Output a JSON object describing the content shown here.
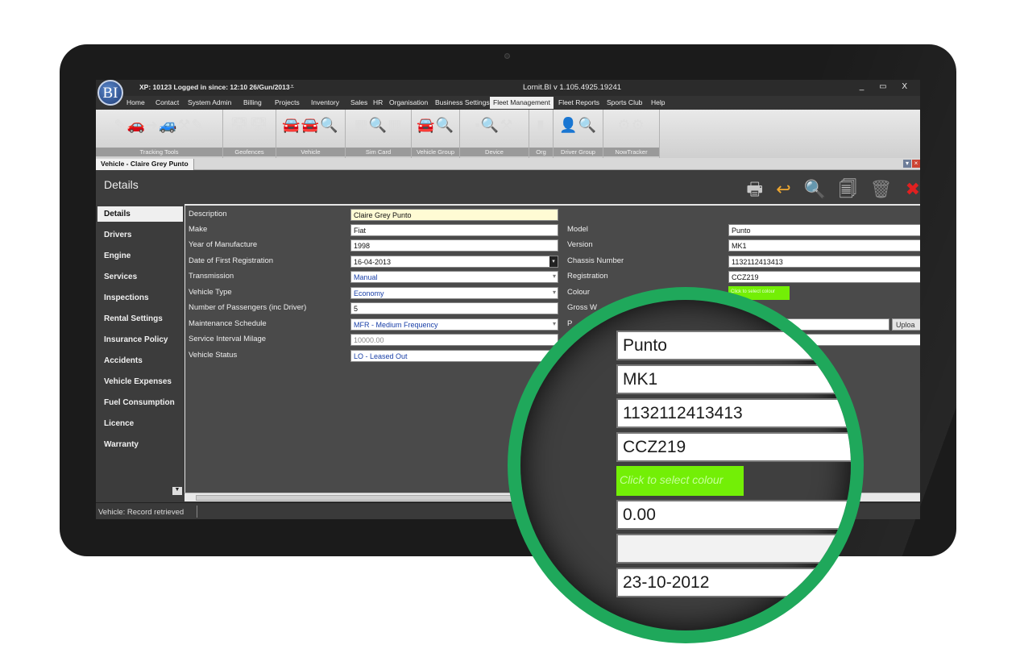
{
  "window": {
    "logo": "BI",
    "session": "XP: 10123  Logged in since: 12:10 26/Gun/2013",
    "quick_access": "⩡",
    "app_title": "Lornit.BI v 1.105.4925.19241",
    "controls": "_ ▭ X"
  },
  "menu": [
    {
      "label": "Home"
    },
    {
      "label": "Contact"
    },
    {
      "label": "System Admin"
    },
    {
      "label": "Billing"
    },
    {
      "label": "Projects"
    },
    {
      "label": "Inventory"
    },
    {
      "label": "Sales"
    },
    {
      "label": "HR"
    },
    {
      "label": "Organisation"
    },
    {
      "label": "Business Settings"
    },
    {
      "label": "Fleet Management"
    },
    {
      "label": "Fleet Reports"
    },
    {
      "label": "Sports Club"
    },
    {
      "label": "Help"
    }
  ],
  "ribbon_groups": [
    {
      "label": "Tracking Tools",
      "icons": "✎🚗➜🚙⚒✎"
    },
    {
      "label": "Geofences",
      "icons": "🛣🛣"
    },
    {
      "label": "Vehicle",
      "icons": "🚘🚘🔍"
    },
    {
      "label": "Sim Card",
      "icons": "▦🔍▦"
    },
    {
      "label": "Vehicle Group",
      "icons": "🚘🔍"
    },
    {
      "label": "Device",
      "icons": "▪🔍⚒"
    },
    {
      "label": "Org",
      "icons": "▮"
    },
    {
      "label": "Driver Group",
      "icons": "👤🔍"
    },
    {
      "label": "NowTracker",
      "icons": "⚙⚙"
    }
  ],
  "doc_tab": "Vehicle - Claire Grey Punto",
  "page_title": "Details",
  "toolbar_icons": [
    "printer-icon",
    "undo-icon",
    "search-icon",
    "copy-icon",
    "delete-icon",
    "close-icon"
  ],
  "sidebar": [
    "Details",
    "Drivers",
    "Engine",
    "Services",
    "Inspections",
    "Rental Settings",
    "Insurance Policy",
    "Accidents",
    "Vehicle Expenses",
    "Fuel Consumption",
    "Licence",
    "Warranty"
  ],
  "form": {
    "description_label": "Description",
    "description_value": "Claire Grey Punto",
    "make_label": "Make",
    "make_value": "Fiat",
    "year_label": "Year of Manufacture",
    "year_value": "1998",
    "first_reg_label": "Date of First Registration",
    "first_reg_value": "16-04-2013",
    "transmission_label": "Transmission",
    "transmission_value": "Manual",
    "vehicle_type_label": "Vehicle Type",
    "vehicle_type_value": "Economy",
    "passengers_label": "Number of Passengers (inc Driver)",
    "passengers_value": "5",
    "maintenance_label": "Maintenance Schedule",
    "maintenance_value": "MFR - Medium Frequency",
    "service_interval_label": "Service Interval Milage",
    "service_interval_value": "10000.00",
    "status_label": "Vehicle Status",
    "status_value": "LO - Leased Out",
    "model_label": "Model",
    "model_value": "Punto",
    "version_label": "Version",
    "version_value": "MK1",
    "chassis_label": "Chassis Number",
    "chassis_value": "1132112413413",
    "registration_label": "Registration",
    "registration_value": "CCZ219",
    "colour_label": "Colour",
    "colour_value": "Click to select colour",
    "gross_label": "Gross W",
    "photo_label": "P",
    "upload_label": "Uploa"
  },
  "status": "Vehicle: Record retrieved",
  "zoom": {
    "model": "Punto",
    "version": "MK1",
    "chassis": "1132112413413",
    "registration": "CCZ219",
    "colour": "Click to select colour",
    "gross_weight": "0.00",
    "blank": "",
    "date": "23-10-2012"
  },
  "colors": {
    "accent_green": "#1fa85b",
    "colour_swatch": "#73ef06"
  }
}
